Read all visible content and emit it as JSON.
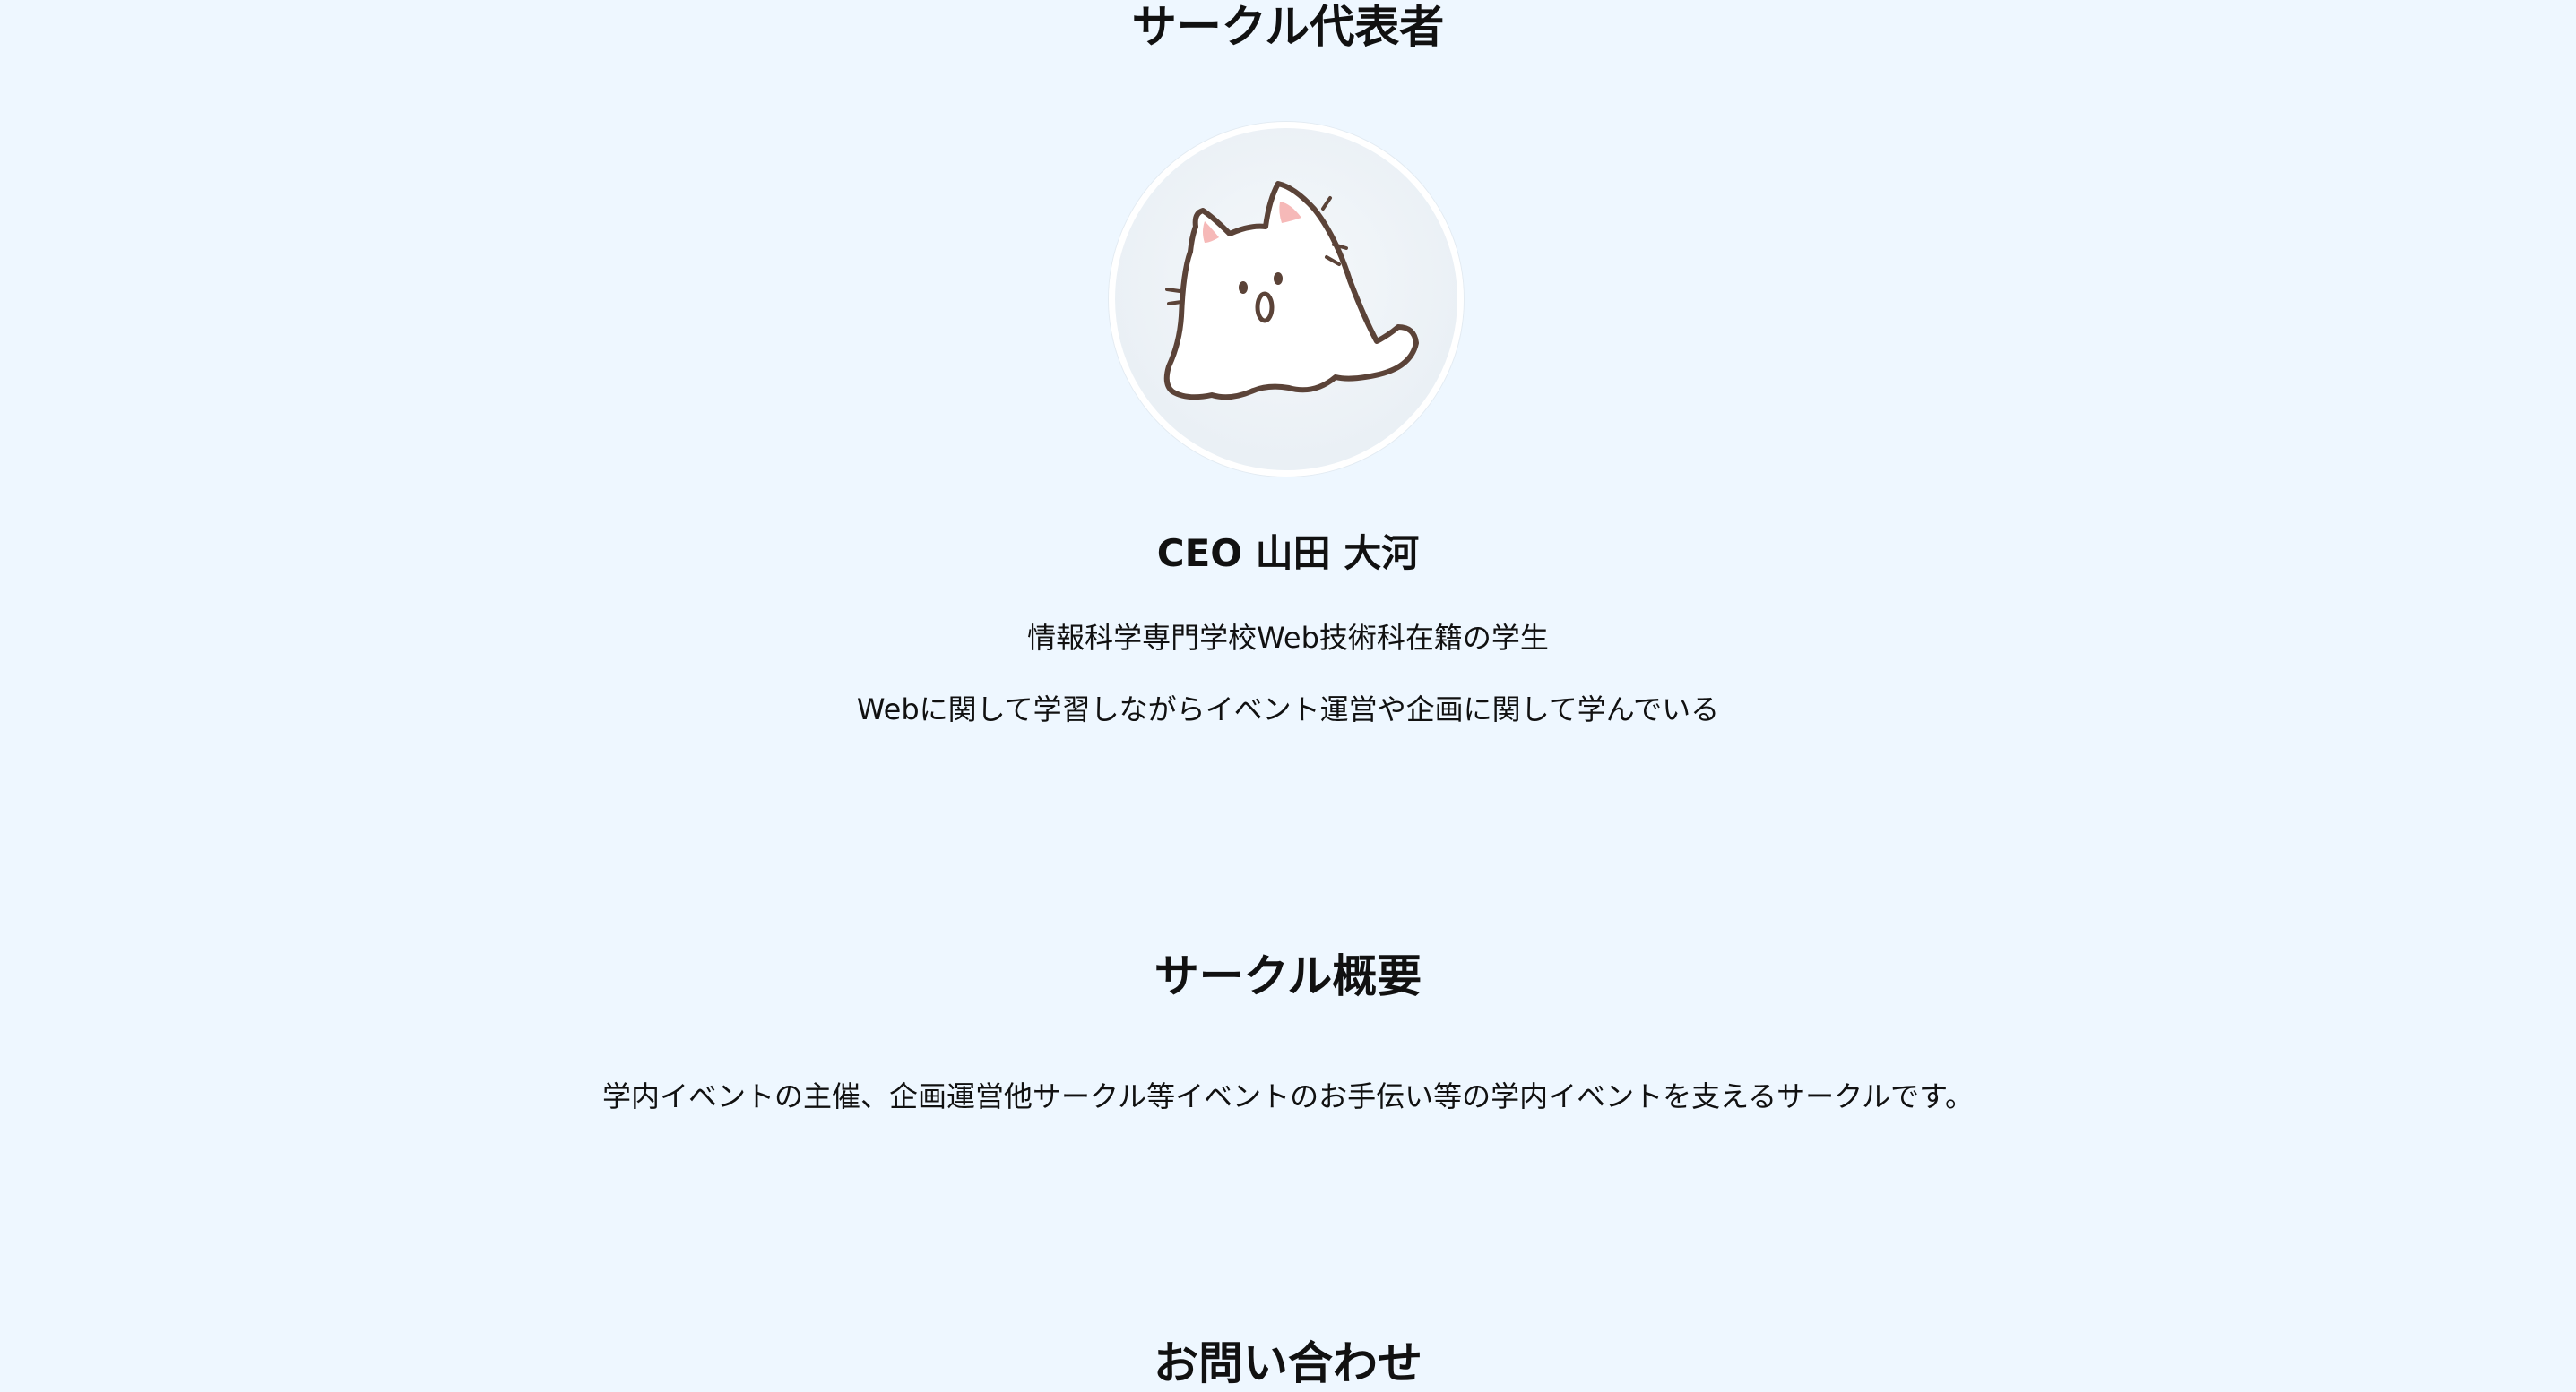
{
  "representative": {
    "section_title": "サークル代表者",
    "avatar_icon": "ghost-cat-icon",
    "name": "CEO 山田 大河",
    "description_1": "情報科学専門学校Web技術科在籍の学生",
    "description_2": "Webに関して学習しながらイベント運営や企画に関して学んでいる"
  },
  "overview": {
    "section_title": "サークル概要",
    "text": "学内イベントの主催、企画運営他サークル等イベントのお手伝い等の学内イベントを支えるサークルです。"
  },
  "contact": {
    "section_title": "お問い合わせ"
  },
  "colors": {
    "background": "#eef7ff",
    "text": "#111111",
    "avatar_border": "#ffffff"
  }
}
